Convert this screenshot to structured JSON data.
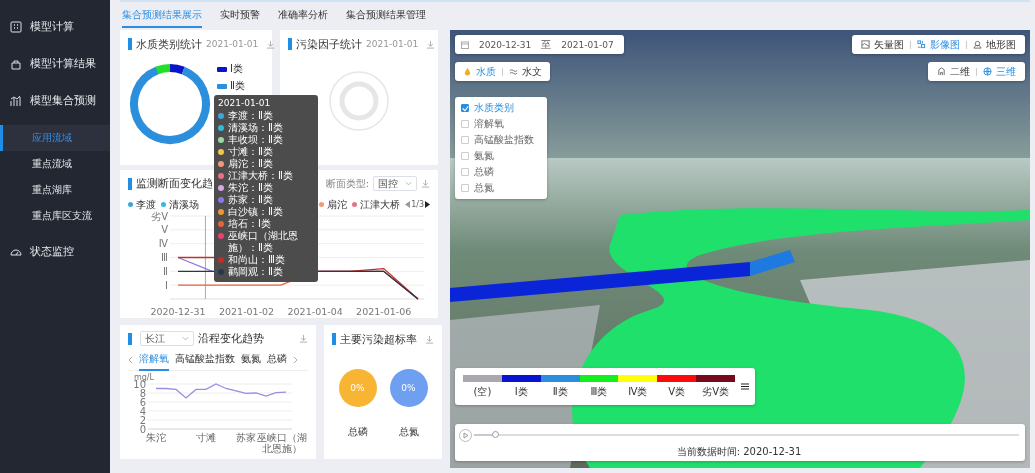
{
  "sidebar": {
    "items": [
      {
        "kind": "grid",
        "label": "模型计算"
      },
      {
        "kind": "box",
        "label": "模型计算结果"
      },
      {
        "kind": "bars",
        "label": "模型集合预测",
        "children": [
          {
            "label": "应用流域",
            "selected": true
          },
          {
            "label": "重点流域",
            "selected": false
          },
          {
            "label": "重点湖库",
            "selected": false
          },
          {
            "label": "重点库区支流",
            "selected": false
          }
        ]
      },
      {
        "kind": "gauge",
        "label": "状态监控"
      }
    ]
  },
  "tabs": [
    {
      "label": "集合预测结果展示",
      "selected": true
    },
    {
      "label": "实时预警",
      "selected": false
    },
    {
      "label": "准确率分析",
      "selected": false
    },
    {
      "label": "集合预测结果管理",
      "selected": false
    }
  ],
  "water_class_panel": {
    "title": "水质类别统计",
    "date": "2021-01-01",
    "legend": [
      {
        "label": "Ⅰ类",
        "color": "#0b14c8"
      },
      {
        "label": "Ⅱ类",
        "color": "#2b8fdc"
      }
    ]
  },
  "pollutant_panel": {
    "title": "污染因子统计",
    "date": "2021-01-01"
  },
  "section_panel": {
    "title": "监测断面变化趋",
    "section_type_label": "断面类型:",
    "section_type_select": {
      "value": "国控"
    },
    "legend": [
      {
        "label": "李渡",
        "color": "#3fa4dc"
      },
      {
        "label": "清溪场",
        "color": "#35b9d8"
      },
      {
        "label": "扇沱",
        "color": "#f09a78"
      },
      {
        "label": "江津大桥",
        "color": "#e8708a"
      }
    ],
    "pager": "1/3",
    "y_axis_labels": [
      "劣Ⅴ",
      "Ⅴ",
      "Ⅳ",
      "Ⅲ",
      "Ⅱ",
      "Ⅰ"
    ],
    "x_axis_labels": [
      "2020-12-31",
      "2021-01-02",
      "2021-01-04",
      "2021-01-06"
    ]
  },
  "tooltip": {
    "title": "2021-01-01",
    "entries": [
      {
        "label": "李渡：Ⅱ类",
        "color": "#3fa4dc"
      },
      {
        "label": "清溪场：Ⅱ类",
        "color": "#35b9d8"
      },
      {
        "label": "丰收坝：Ⅱ类",
        "color": "#9bd8a0"
      },
      {
        "label": "寸滩：Ⅱ类",
        "color": "#f0c84a"
      },
      {
        "label": "扇沱：Ⅱ类",
        "color": "#f09a78"
      },
      {
        "label": "江津大桥：Ⅱ类",
        "color": "#e8708a"
      },
      {
        "label": "朱沱：Ⅱ类",
        "color": "#d8a8e0"
      },
      {
        "label": "苏家：Ⅱ类",
        "color": "#8878e0"
      },
      {
        "label": "白沙镇：Ⅱ类",
        "color": "#f0962e"
      },
      {
        "label": "培石：Ⅰ类",
        "color": "#e8603c"
      },
      {
        "label": "巫峡口（湖北恩施）：Ⅱ类",
        "color": "#e84070"
      },
      {
        "label": "和尚山：Ⅲ类",
        "color": "#c03028"
      },
      {
        "label": "鹳岡观：Ⅱ类",
        "color": "#283848"
      }
    ]
  },
  "trend_panel": {
    "river_select": {
      "value": "长江"
    },
    "title": "沿程变化趋势",
    "tabs": [
      {
        "label": "溶解氧",
        "selected": true
      },
      {
        "label": "高锰酸盐指数",
        "selected": false
      },
      {
        "label": "氨氮",
        "selected": false
      },
      {
        "label": "总磷",
        "selected": false
      }
    ],
    "chart_data": {
      "type": "line",
      "grid": true,
      "ylabel": "mg/L",
      "categories": [
        "朱沱",
        null,
        null,
        null,
        null,
        "寸滩",
        null,
        null,
        null,
        "苏家",
        null,
        null,
        null,
        "巫峡口（湖北恩施）"
      ],
      "ylim": [
        0,
        10
      ],
      "yticks": [
        0,
        2,
        4,
        6,
        8,
        10
      ],
      "series": [
        {
          "color": "#9a8ee0",
          "values": [
            9,
            9,
            8.8,
            6.9,
            8.8,
            8.8,
            10,
            9,
            8.5,
            7.9,
            8,
            7.3,
            8.1,
            8.2
          ]
        }
      ]
    }
  },
  "exceed_panel": {
    "title": "主要污染超标率",
    "items": [
      {
        "value": "0%",
        "label": "总磷",
        "color": "#f8b534"
      },
      {
        "value": "0%",
        "label": "总氮",
        "color": "#6f9ff0"
      }
    ]
  },
  "map": {
    "date_range": {
      "start": "2020-12-31",
      "separator": "至",
      "end": "2021-01-07"
    },
    "base_layers": [
      {
        "kind": "vector",
        "label": "矢量图",
        "selected": false
      },
      {
        "kind": "image",
        "label": "影像图",
        "selected": true
      },
      {
        "kind": "terrain",
        "label": "地形图",
        "selected": false
      }
    ],
    "themes": [
      {
        "kind": "drop",
        "label": "水质",
        "selected": true
      },
      {
        "kind": "wave",
        "label": "水文",
        "selected": false
      }
    ],
    "views": [
      {
        "kind": "flat",
        "label": "二维",
        "selected": false
      },
      {
        "kind": "globe",
        "label": "三维",
        "selected": true
      }
    ],
    "layers": [
      {
        "label": "水质类别",
        "checked": true
      },
      {
        "label": "溶解氧",
        "checked": false
      },
      {
        "label": "高锰酸盐指数",
        "checked": false
      },
      {
        "label": "氨氮",
        "checked": false
      },
      {
        "label": "总磷",
        "checked": false
      },
      {
        "label": "总氮",
        "checked": false
      }
    ],
    "legend": [
      {
        "label": "(空)",
        "color": "#a8a8b0"
      },
      {
        "label": "Ⅰ类",
        "color": "#0a14d0"
      },
      {
        "label": "Ⅱ类",
        "color": "#2a8ee0"
      },
      {
        "label": "Ⅲ类",
        "color": "#12f01e"
      },
      {
        "label": "Ⅳ类",
        "color": "#ffff0a"
      },
      {
        "label": "Ⅴ类",
        "color": "#ff0a0a"
      },
      {
        "label": "劣Ⅴ类",
        "color": "#780a20"
      }
    ],
    "timeline": {
      "level": 0.04,
      "caption": "当前数据时间: 2020-12-31"
    }
  }
}
